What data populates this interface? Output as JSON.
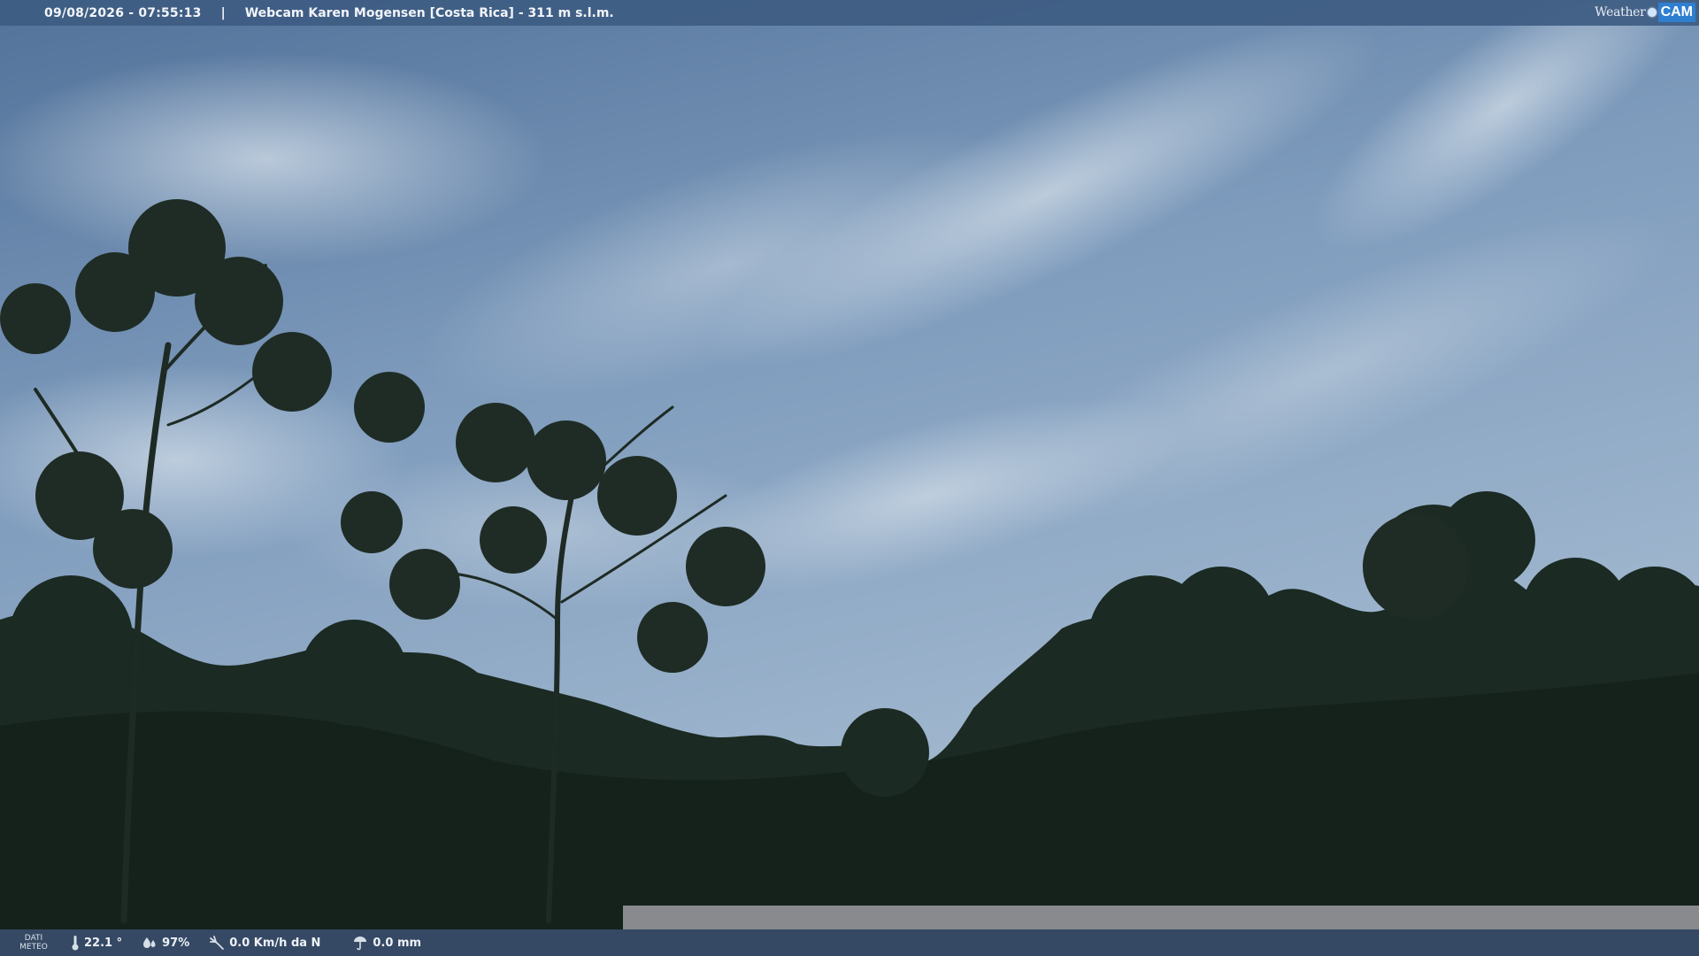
{
  "header": {
    "datetime": "09/08/2026 - 07:55:13",
    "separator": "|",
    "title": "Webcam Karen Mogensen [Costa Rica] - 311 m s.l.m.",
    "logo": {
      "weather": "Weather",
      "cam": "CAM"
    }
  },
  "footer": {
    "label_line1": "DATI",
    "label_line2": "METEO",
    "temperature": "22.1 °",
    "humidity": "97%",
    "wind": "0.0 Km/h da N",
    "rain": "0.0 mm"
  },
  "icons": {
    "temperature": "thermometer-icon",
    "humidity": "humidity-icon",
    "wind": "wind-icon",
    "rain": "rain-icon"
  },
  "colors": {
    "sky_top": "#5a7aa0",
    "sky_bottom": "#9fb6cc",
    "vegetation": "#1a2820",
    "bar": "#3e5c82",
    "logo_blue": "#2f7fd0"
  }
}
